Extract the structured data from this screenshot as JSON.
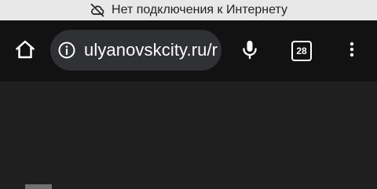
{
  "status_bar": {
    "offline_message": "Нет подключения к Интернету",
    "icon": "cloud-off-icon"
  },
  "toolbar": {
    "home_icon": "home-icon",
    "address": {
      "url_text": "ulyanovskcity.ru/r",
      "site_info_icon": "info-icon"
    },
    "voice_icon": "microphone-icon",
    "tab_count": "28",
    "menu_icon": "more-vert-icon"
  },
  "colors": {
    "offline_bar": "#e8e8e8",
    "toolbar": "#121212",
    "omnibox": "#303134",
    "page": "#1f1f1f"
  }
}
